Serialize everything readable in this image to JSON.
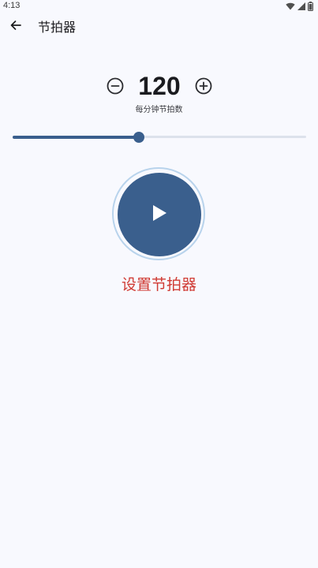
{
  "status_bar": {
    "time": "4:13",
    "icons": [
      "wifi-icon",
      "signal-icon",
      "battery-icon"
    ]
  },
  "app_bar": {
    "title": "节拍器",
    "back_icon": "arrow-left-icon"
  },
  "tempo": {
    "value": "120",
    "caption": "每分钟节拍数",
    "slider_fraction": 0.43
  },
  "actions": {
    "play_icon": "play-icon",
    "settings_label": "设置节拍器"
  },
  "colors": {
    "accent": "#3a5f8d",
    "ring": "#b8d3ec",
    "link": "#d03b34",
    "background": "#f8f9fe"
  }
}
